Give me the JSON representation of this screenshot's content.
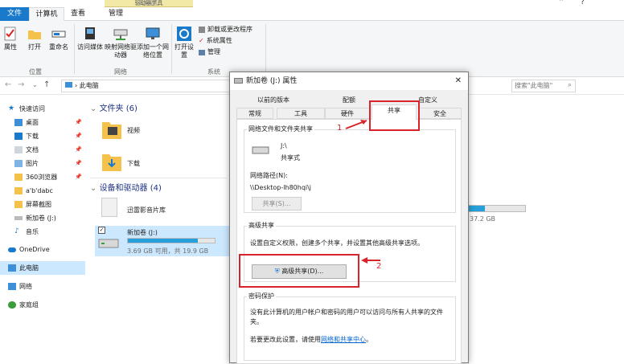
{
  "window": {
    "context_tab": "驱动器工具",
    "title_frag": "此电脑"
  },
  "ribbon_tabs": [
    "文件",
    "计算机",
    "查看",
    "管理"
  ],
  "ribbon": {
    "location": {
      "label": "位置",
      "buttons": [
        "属性",
        "打开",
        "重命名"
      ]
    },
    "network": {
      "label": "网络",
      "buttons": [
        "访问媒体",
        "映射网络驱动器",
        "添加一个网络位置"
      ]
    },
    "system": {
      "label": "系统",
      "open_settings": "打开设置",
      "items": [
        "卸载或更改程序",
        "系统属性",
        "管理"
      ]
    }
  },
  "address": {
    "path": "此电脑",
    "search_placeholder": "搜索\"此电脑\""
  },
  "nav": {
    "quick": "快速访问",
    "items": [
      "桌面",
      "下载",
      "文档",
      "图片",
      "360浏览器",
      "a'b'dabc",
      "屏幕截图",
      "新加卷 (J:)",
      "音乐"
    ],
    "onedrive": "OneDrive",
    "thispc": "此电脑",
    "network": "网络",
    "homegroup": "家庭组"
  },
  "main": {
    "folders_header": "文件夹 (6)",
    "folders": [
      "视频",
      "下载"
    ],
    "devices_header": "设备和驱动器 (4)",
    "drives": [
      {
        "name": "迅雷影音片库"
      },
      {
        "name": "新加卷 (J:)",
        "free": "3.69 GB 可用，共 19.9 GB",
        "used": 0.81
      },
      {
        "free_tail": "37.2 GB"
      }
    ]
  },
  "dialog": {
    "title": "新加卷 (J:) 属性",
    "tabs_row1": [
      "以前的版本",
      "配额",
      "自定义"
    ],
    "tabs_row2": [
      "常规",
      "工具",
      "硬件",
      "共享",
      "安全"
    ],
    "net_share": {
      "legend": "网络文件和文件夹共享",
      "drive": "J:\\",
      "status": "共享式",
      "path_label": "网络路径(N):",
      "path": "\\\\Desktop-lh80hqi\\j",
      "share_btn": "共享(S)..."
    },
    "adv": {
      "legend": "高级共享",
      "desc": "设置自定义权限，创建多个共享，并设置其他高级共享选项。",
      "btn": "高级共享(D)..."
    },
    "pwd": {
      "legend": "密码保护",
      "desc": "没有此计算机的用户帐户和密码的用户可以访问与所有人共享的文件夹。",
      "change_prefix": "若要更改此设置，请使用",
      "link": "网络和共享中心",
      "suffix": "。"
    },
    "close": "✕"
  },
  "annotations": [
    "1",
    "2"
  ],
  "colors": {
    "accent": "#1979ca",
    "red": "#d9222a",
    "drive_bar": "#26a0da"
  }
}
